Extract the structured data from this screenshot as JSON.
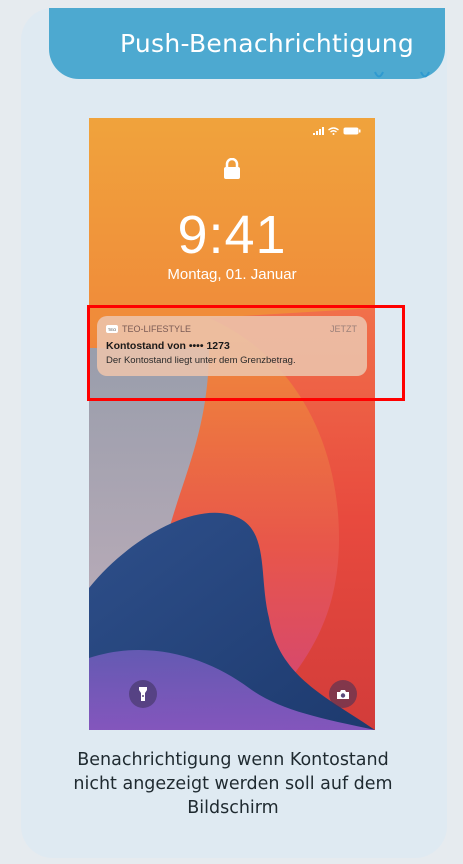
{
  "header": {
    "title": "Push-Benachrichtigung"
  },
  "lockscreen": {
    "time": "9:41",
    "date": "Montag, 01. Januar"
  },
  "notification": {
    "app_icon_text": "TEO",
    "app_name": "TEO-LIFESTYLE",
    "time_label": "JETZT",
    "title": "Kontostand von •••• 1273",
    "body": "Der Kontostand liegt unter dem Grenzbetrag."
  },
  "caption": {
    "line1": "Benachrichtigung wenn Kontostand",
    "line2": "nicht angezeigt werden soll auf dem",
    "line3": "Bildschirm"
  },
  "colors": {
    "header_bg": "#4da9d0",
    "card_bg": "#dfeaf2",
    "highlight": "#ff0000"
  },
  "icons": [
    "lock-icon",
    "signal-icon",
    "wifi-icon",
    "battery-icon",
    "flashlight-icon",
    "camera-icon"
  ]
}
